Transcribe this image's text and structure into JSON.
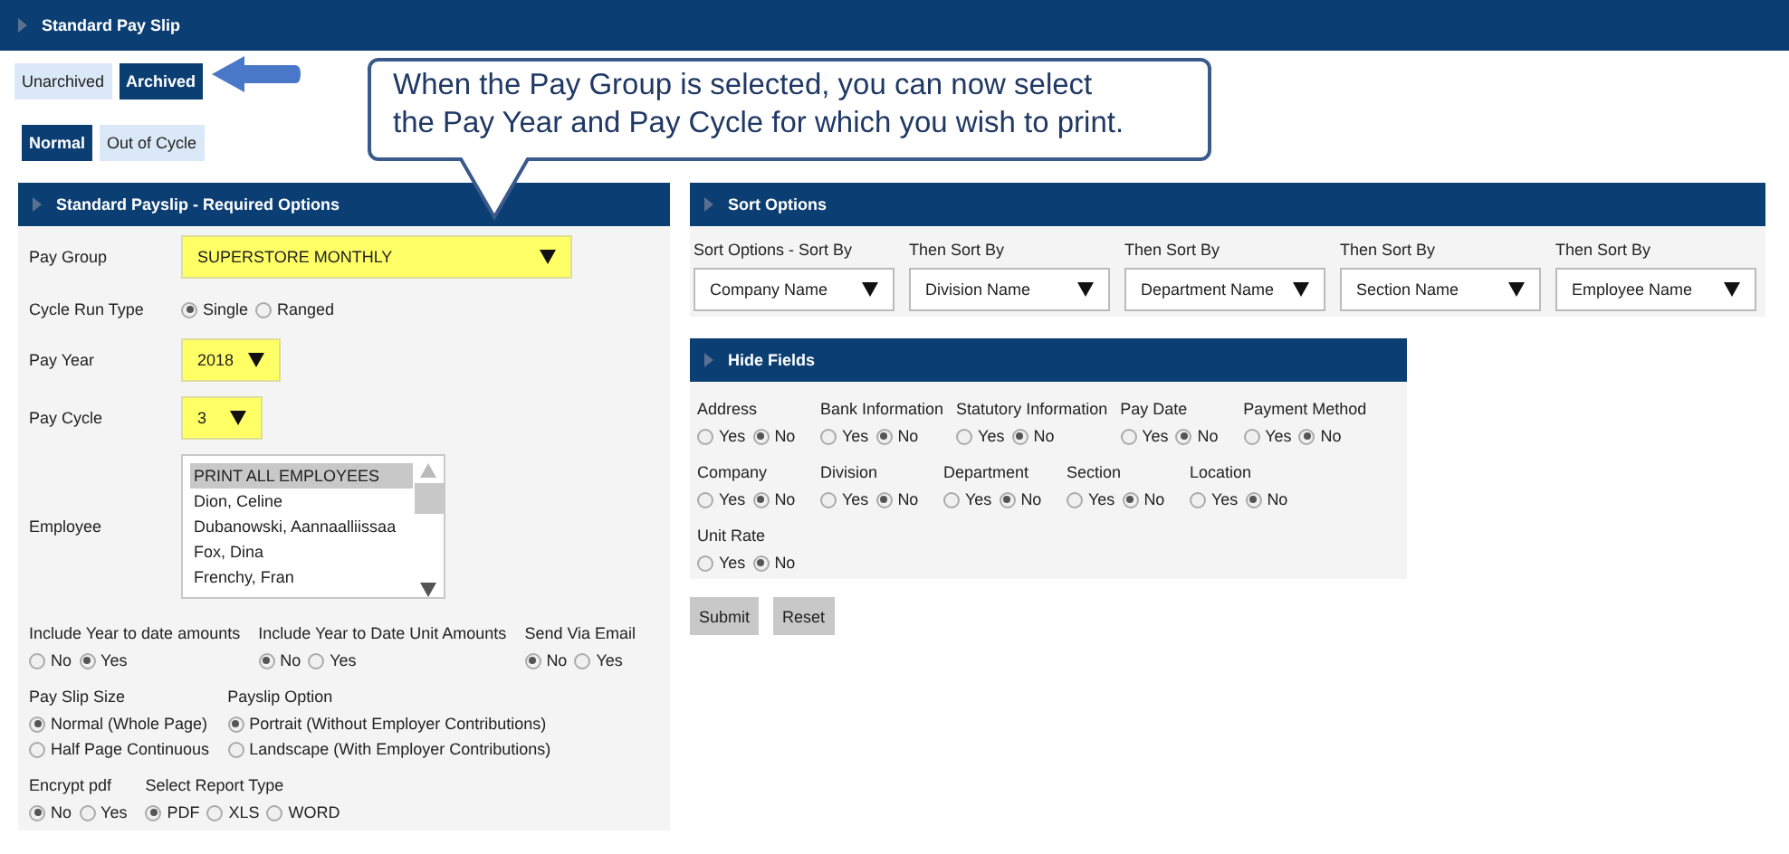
{
  "header": {
    "title": "Standard Pay Slip"
  },
  "archive_tabs": [
    {
      "label": "Unarchived",
      "selected": false
    },
    {
      "label": "Archived",
      "selected": true
    }
  ],
  "cycle_tabs": [
    {
      "label": "Normal",
      "selected": true
    },
    {
      "label": "Out of Cycle",
      "selected": false
    }
  ],
  "callout": {
    "text": "When the Pay Group is selected, you can now select\nthe Pay Year and Pay Cycle for which you wish to print."
  },
  "required_options": {
    "title": "Standard Payslip - Required Options",
    "pay_group": {
      "label": "Pay Group",
      "value": "SUPERSTORE MONTHLY"
    },
    "cycle_run_type": {
      "label": "Cycle Run Type",
      "options": [
        {
          "label": "Single",
          "selected": true
        },
        {
          "label": "Ranged",
          "selected": false
        }
      ]
    },
    "pay_year": {
      "label": "Pay Year",
      "value": "2018"
    },
    "pay_cycle": {
      "label": "Pay Cycle",
      "value": "3"
    },
    "employee": {
      "label": "Employee",
      "items": [
        {
          "label": "PRINT ALL EMPLOYEES",
          "selected": true
        },
        {
          "label": "Dion, Celine",
          "selected": false
        },
        {
          "label": "Dubanowski, Aannaalliissaa",
          "selected": false
        },
        {
          "label": "Fox, Dina",
          "selected": false
        },
        {
          "label": "Frenchy, Fran",
          "selected": false
        }
      ]
    },
    "option_rows": [
      [
        {
          "label": "Include Year to date amounts",
          "options": [
            {
              "label": "No",
              "selected": false
            },
            {
              "label": "Yes",
              "selected": true
            }
          ]
        },
        {
          "label": "Include Year to Date Unit Amounts",
          "options": [
            {
              "label": "No",
              "selected": true
            },
            {
              "label": "Yes",
              "selected": false
            }
          ]
        },
        {
          "label": "Send Via Email",
          "options": [
            {
              "label": "No",
              "selected": true
            },
            {
              "label": "Yes",
              "selected": false
            }
          ]
        }
      ],
      [
        {
          "label": "Pay Slip Size",
          "stacked": true,
          "options": [
            {
              "label": "Normal (Whole Page)",
              "selected": true
            },
            {
              "label": "Half Page Continuous",
              "selected": false
            }
          ]
        },
        {
          "label": "Payslip Option",
          "stacked": true,
          "options": [
            {
              "label": "Portrait (Without Employer Contributions)",
              "selected": true
            },
            {
              "label": "Landscape (With Employer Contributions)",
              "selected": false
            }
          ]
        }
      ],
      [
        {
          "label": "Encrypt pdf",
          "options": [
            {
              "label": "No",
              "selected": true
            },
            {
              "label": "Yes",
              "selected": false
            }
          ]
        },
        {
          "label": "Select Report Type",
          "options": [
            {
              "label": "PDF",
              "selected": true
            },
            {
              "label": "XLS",
              "selected": false
            },
            {
              "label": "WORD",
              "selected": false
            }
          ]
        }
      ]
    ]
  },
  "sort_options": {
    "title": "Sort Options",
    "fields": [
      {
        "label": "Sort Options - Sort By",
        "value": "Company Name"
      },
      {
        "label": "Then Sort By",
        "value": "Division Name"
      },
      {
        "label": "Then Sort By",
        "value": "Department Name"
      },
      {
        "label": "Then Sort By",
        "value": "Section Name"
      },
      {
        "label": "Then Sort By",
        "value": "Employee Name"
      }
    ]
  },
  "hide_fields": {
    "title": "Hide Fields",
    "rows": [
      [
        {
          "label": "Address",
          "options": [
            {
              "label": "Yes",
              "selected": false
            },
            {
              "label": "No",
              "selected": true
            }
          ]
        },
        {
          "label": "Bank Information",
          "options": [
            {
              "label": "Yes",
              "selected": false
            },
            {
              "label": "No",
              "selected": true
            }
          ]
        },
        {
          "label": "Statutory Information",
          "options": [
            {
              "label": "Yes",
              "selected": false
            },
            {
              "label": "No",
              "selected": true
            }
          ]
        },
        {
          "label": "Pay Date",
          "options": [
            {
              "label": "Yes",
              "selected": false
            },
            {
              "label": "No",
              "selected": true
            }
          ]
        },
        {
          "label": "Payment Method",
          "options": [
            {
              "label": "Yes",
              "selected": false
            },
            {
              "label": "No",
              "selected": true
            }
          ]
        }
      ],
      [
        {
          "label": "Company",
          "options": [
            {
              "label": "Yes",
              "selected": false
            },
            {
              "label": "No",
              "selected": true
            }
          ]
        },
        {
          "label": "Division",
          "options": [
            {
              "label": "Yes",
              "selected": false
            },
            {
              "label": "No",
              "selected": true
            }
          ]
        },
        {
          "label": "Department",
          "options": [
            {
              "label": "Yes",
              "selected": false
            },
            {
              "label": "No",
              "selected": true
            }
          ]
        },
        {
          "label": "Section",
          "options": [
            {
              "label": "Yes",
              "selected": false
            },
            {
              "label": "No",
              "selected": true
            }
          ]
        },
        {
          "label": "Location",
          "options": [
            {
              "label": "Yes",
              "selected": false
            },
            {
              "label": "No",
              "selected": true
            }
          ]
        }
      ],
      [
        {
          "label": "Unit Rate",
          "options": [
            {
              "label": "Yes",
              "selected": false
            },
            {
              "label": "No",
              "selected": true
            }
          ]
        }
      ]
    ]
  },
  "buttons": [
    "Submit",
    "Reset"
  ]
}
